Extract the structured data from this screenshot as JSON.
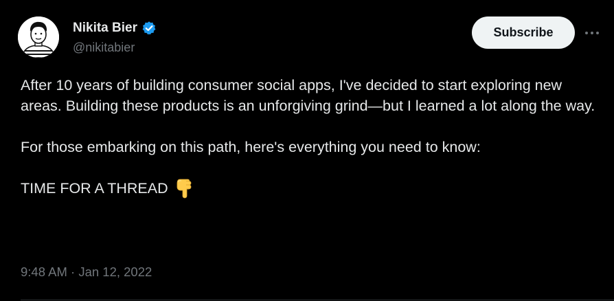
{
  "author": {
    "name": "Nikita Bier",
    "handle": "@nikitabier",
    "verified": true,
    "verified_color": "#1d9bf0"
  },
  "header": {
    "subscribe_label": "Subscribe",
    "more_icon": "more-horizontal-icon"
  },
  "tweet": {
    "paragraph_1": "After 10 years of building consumer social apps, I've decided to start exploring new areas. Building these products is an unforgiving grind—but I learned a lot along the way.",
    "paragraph_2": "For those embarking on this path, here's everything you need to know:",
    "paragraph_3": "TIME FOR A THREAD",
    "emoji_icon": "backhand-index-pointing-down-icon"
  },
  "meta": {
    "timestamp": "9:48 AM · Jan 12, 2022"
  },
  "colors": {
    "background": "#000000",
    "text": "#e7e9ea",
    "secondary_text": "#71767b",
    "button_bg": "#eff3f4",
    "button_text": "#0f1419",
    "divider": "#2f3336"
  }
}
